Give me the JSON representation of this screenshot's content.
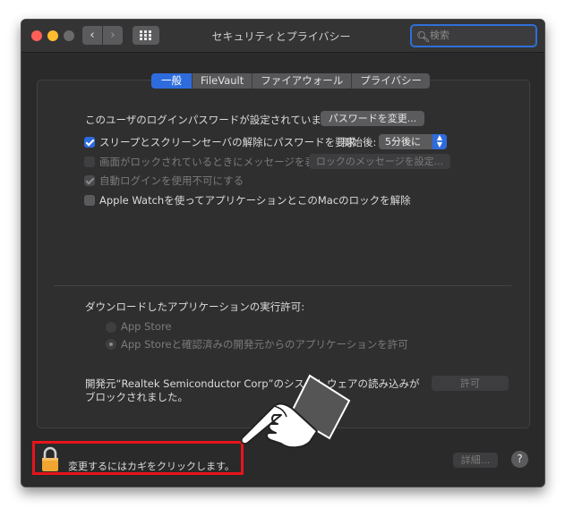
{
  "window": {
    "title": "セキュリティとプライバシー",
    "search_placeholder": "検索",
    "back_icon": "‹",
    "forward_icon": "›"
  },
  "tabs": [
    {
      "label": "一般",
      "active": true
    },
    {
      "label": "FileVault",
      "active": false
    },
    {
      "label": "ファイアウォール",
      "active": false
    },
    {
      "label": "プライバシー",
      "active": false
    }
  ],
  "general": {
    "password_text": "このユーザのログインパスワードが設定されています",
    "change_password_button": "パスワードを変更...",
    "require_password_label": "スリープとスクリーンセーバの解除にパスワードを要求",
    "require_password_checked": true,
    "start_label": "開始後:",
    "delay_value": "5分後に",
    "show_message_label": "画面がロックされているときにメッセージを表示",
    "show_message_checked": false,
    "set_message_button": "ロックのメッセージを設定...",
    "disable_autologin_label": "自動ログインを使用不可にする",
    "disable_autologin_checked": true,
    "apple_watch_label": "Apple Watchを使ってアプリケーションとこのMacのロックを解除",
    "apple_watch_checked": false
  },
  "downloads": {
    "heading": "ダウンロードしたアプリケーションの実行許可:",
    "option_app_store": "App Store",
    "option_identified": "App Storeと確認済みの開発元からのアプリケーションを許可",
    "selected": "identified"
  },
  "system_ext": {
    "message_line1": "開発元“Realtek Semiconductor Corp”のシステム",
    "message_line1_tail": "ウェアの読み込みが",
    "message_line2": "ブロックされました。",
    "allow_button": "許可"
  },
  "footer": {
    "lock_text": "変更するにはカギをクリックします。",
    "advanced_button": "詳細...",
    "help_label": "?"
  },
  "colors": {
    "accent": "#2e6cde",
    "highlight_box": "#e8141b",
    "window_bg": "#2a2a2b"
  }
}
